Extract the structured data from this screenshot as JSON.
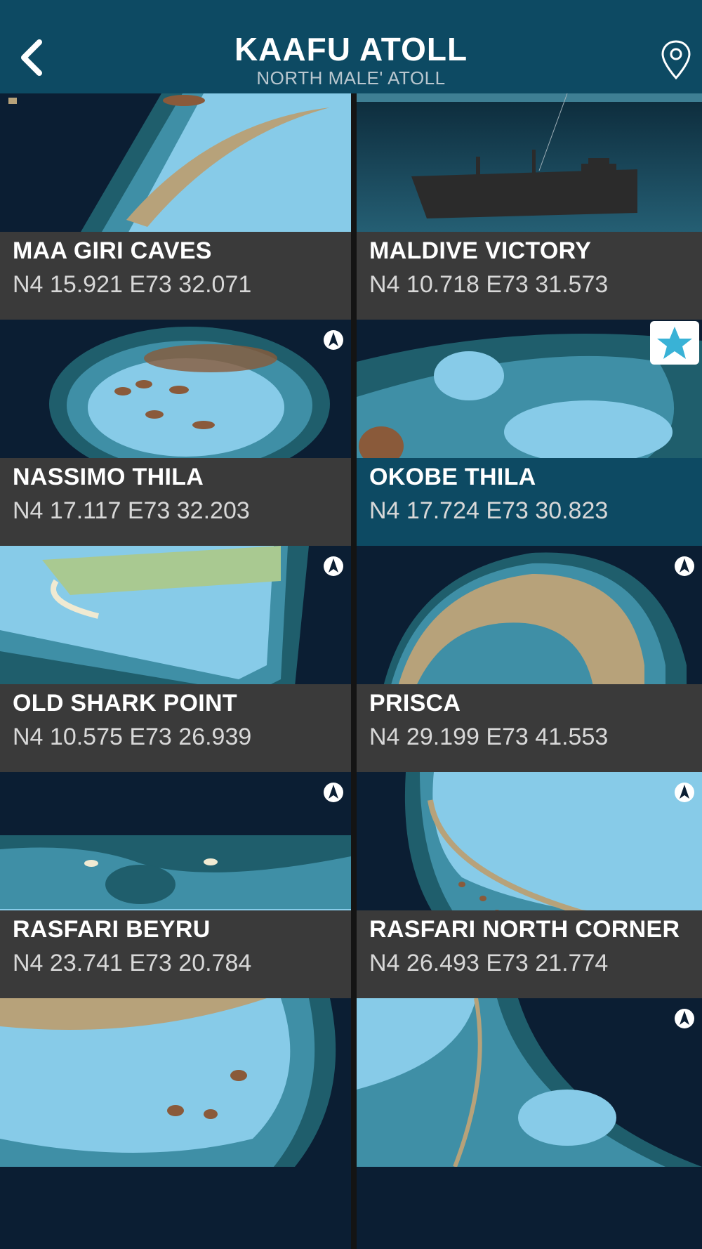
{
  "header": {
    "title": "KAAFU ATOLL",
    "subtitle": "NORTH MALE' ATOLL"
  },
  "sites": [
    {
      "name": "MAA GIRI CAVES",
      "coords": "N4 15.921 E73 32.071"
    },
    {
      "name": "MALDIVE VICTORY",
      "coords": "N4 10.718 E73 31.573"
    },
    {
      "name": "NASSIMO THILA",
      "coords": "N4 17.117 E73 32.203"
    },
    {
      "name": "OKOBE THILA",
      "coords": "N4 17.724 E73 30.823"
    },
    {
      "name": "OLD SHARK POINT",
      "coords": "N4 10.575 E73 26.939"
    },
    {
      "name": "PRISCA",
      "coords": "N4 29.199 E73 41.553"
    },
    {
      "name": "RASFARI BEYRU",
      "coords": "N4 23.741 E73 20.784"
    },
    {
      "name": "RASFARI NORTH CORNER",
      "coords": "N4 26.493 E73 21.774"
    }
  ],
  "colors": {
    "header": "#0d4a63",
    "deep": "#0b1e33",
    "lagoon": "#87cbe8",
    "reef": "#3f8fa6",
    "sand": "#b7a27a",
    "coral": "#8a5a3a",
    "island": "#a9c991",
    "favorite": "#39b2d6"
  }
}
